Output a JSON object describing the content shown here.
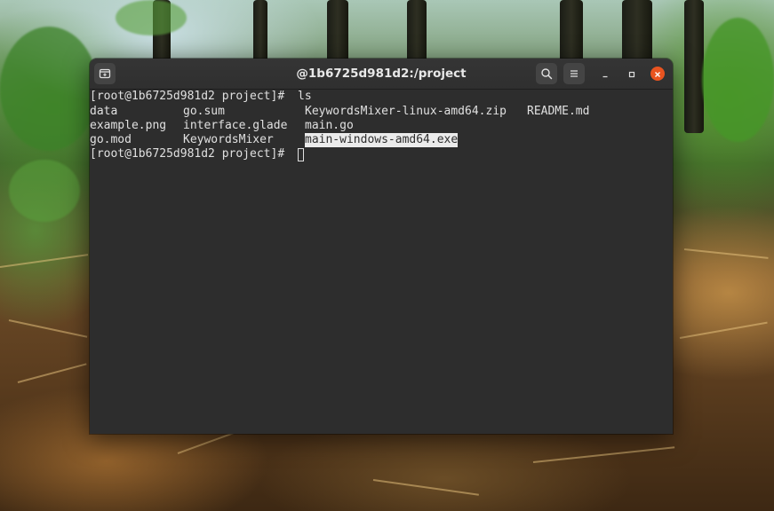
{
  "window": {
    "title": "@1b6725d981d2:/project",
    "buttons": {
      "new_tab_icon": "new-tab-icon",
      "search_icon": "search-icon",
      "menu_icon": "hamburger-menu-icon",
      "minimize_icon": "minimize-icon",
      "maximize_icon": "maximize-icon",
      "close_icon": "close-icon"
    },
    "colors": {
      "terminal_background": "#2d2d2d",
      "terminal_text": "#e0e0e0",
      "close_button": "#e95420",
      "selection_background": "#ebebeb"
    }
  },
  "terminal": {
    "prompt_1": "[root@1b6725d981d2 project]# ",
    "command_1": "ls",
    "listing": [
      [
        "data",
        "go.sum",
        "KeywordsMixer-linux-amd64.zip",
        "README.md"
      ],
      [
        "example.png",
        "interface.glade",
        "main.go",
        ""
      ],
      [
        "go.mod",
        "KeywordsMixer",
        "main-windows-amd64.exe",
        ""
      ]
    ],
    "selected_text": "main-windows-amd64.exe",
    "prompt_2": "[root@1b6725d981d2 project]# "
  }
}
